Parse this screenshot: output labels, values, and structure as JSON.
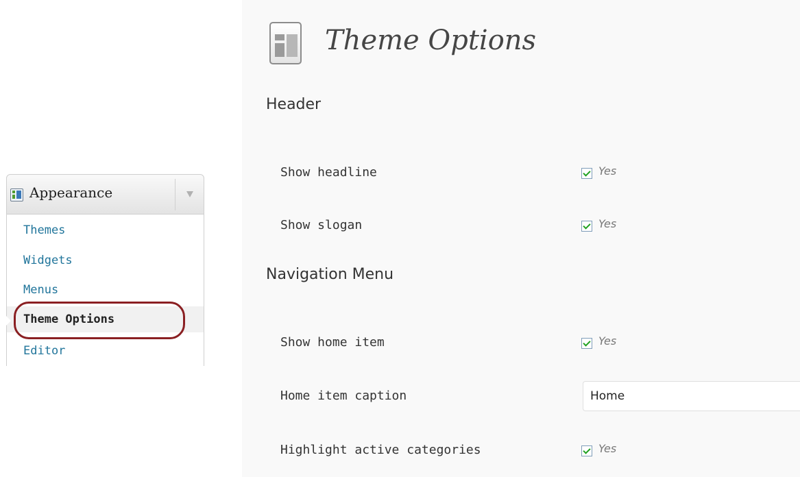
{
  "sidebar": {
    "section_label": "Appearance",
    "items": [
      {
        "label": "Themes"
      },
      {
        "label": "Widgets"
      },
      {
        "label": "Menus"
      },
      {
        "label": "Theme Options"
      },
      {
        "label": "Editor"
      }
    ],
    "current_item": "Theme Options"
  },
  "main": {
    "title": "Theme Options",
    "sections": [
      {
        "title": "Header",
        "options": [
          {
            "label": "Show headline",
            "checked": true,
            "check_label": "Yes"
          },
          {
            "label": "Show slogan",
            "checked": true,
            "check_label": "Yes"
          }
        ]
      },
      {
        "title": "Navigation Menu",
        "options": [
          {
            "label": "Show home item",
            "checked": true,
            "check_label": "Yes"
          },
          {
            "label": "Home item caption",
            "value": "Home"
          },
          {
            "label": "Highlight active categories",
            "checked": true,
            "check_label": "Yes"
          }
        ]
      }
    ]
  },
  "colors": {
    "link": "#21759b",
    "highlight_ring": "#8a1f22",
    "check_tick": "#21a121",
    "page_background": "#f9f9f9"
  },
  "icons": {
    "appearance": "appearance-icon",
    "page": "theme-options-page-icon",
    "toggle": "menu-toggle-arrow-icon",
    "check": "checkmark-icon"
  }
}
